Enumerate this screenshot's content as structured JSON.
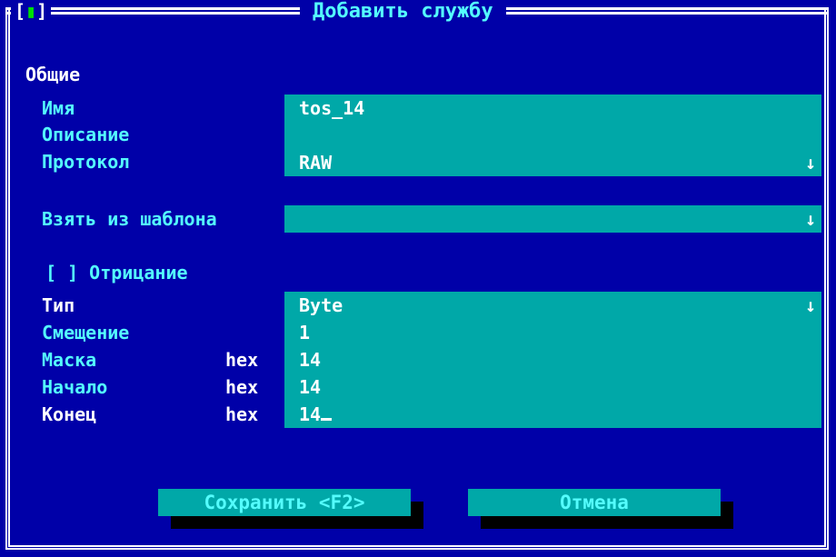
{
  "window": {
    "title": "Добавить службу",
    "control_left": "[",
    "control_mid": "▮",
    "control_right": "]"
  },
  "section_general": "Общие",
  "fields": {
    "name": {
      "label": "Имя",
      "value": "tos_14"
    },
    "description": {
      "label": "Описание",
      "value": ""
    },
    "protocol": {
      "label": "Протокол",
      "value": "RAW",
      "arrow": "↓"
    },
    "template": {
      "label": "Взять из шаблона",
      "value": "",
      "arrow": "↓"
    },
    "negation": {
      "label": "[ ] Отрицание"
    },
    "type": {
      "label": "Тип",
      "value": "Byte",
      "arrow": "↓"
    },
    "offset": {
      "label": "Смещение",
      "value": "1"
    },
    "mask": {
      "label": "Маска",
      "unit": "hex",
      "value": "14"
    },
    "start": {
      "label": "Начало",
      "unit": "hex",
      "value": "14"
    },
    "end": {
      "label": "Конец",
      "unit": "hex",
      "value": "14"
    }
  },
  "buttons": {
    "save": "Сохранить <F2>",
    "cancel": "Отмена"
  },
  "colors": {
    "background": "#0000a8",
    "field": "#00a8a8",
    "label": "#54fcfc",
    "text": "#ffffff"
  }
}
